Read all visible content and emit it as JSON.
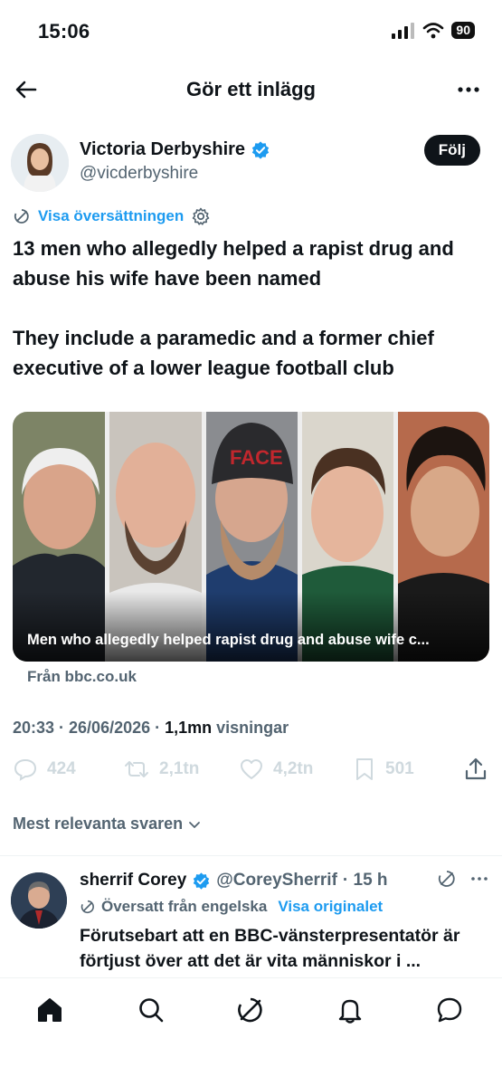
{
  "status_bar": {
    "time": "15:06",
    "battery": "90"
  },
  "header": {
    "title": "Gör ett inlägg"
  },
  "author": {
    "name": "Victoria Derbyshire",
    "handle": "@vicderbyshire",
    "follow_label": "Följ"
  },
  "translate": {
    "label": "Visa översättningen"
  },
  "post": {
    "paragraphs": [
      "13 men who allegedly helped a rapist drug and abuse his wife have been named",
      "They include a paramedic and a former chief executive of a lower league football club"
    ]
  },
  "media": {
    "caption": "Men who allegedly helped rapist drug and abuse wife c...",
    "source": "Från bbc.co.uk"
  },
  "timestamp": {
    "time": "20:33 · 26/06/2026 · ",
    "views_count": "1,1mn",
    "views_label": " visningar"
  },
  "actions": {
    "replies": "424",
    "reposts": "2,1tn",
    "likes": "4,2tn",
    "bookmarks": "501"
  },
  "sort": {
    "label": "Mest relevanta svaren"
  },
  "reply": {
    "name": "sherrif Corey",
    "handle": "@CoreySherrif",
    "time": "· 15 h",
    "translated_label": "Översatt från engelska",
    "show_original": "Visa originalet",
    "text": "Förutsebart att en BBC-vänsterpresentatör är förtjust över att det är vita människor i ..."
  },
  "colors": {
    "accent": "#1d9bf0",
    "text": "#0f1419",
    "muted": "#536471"
  }
}
